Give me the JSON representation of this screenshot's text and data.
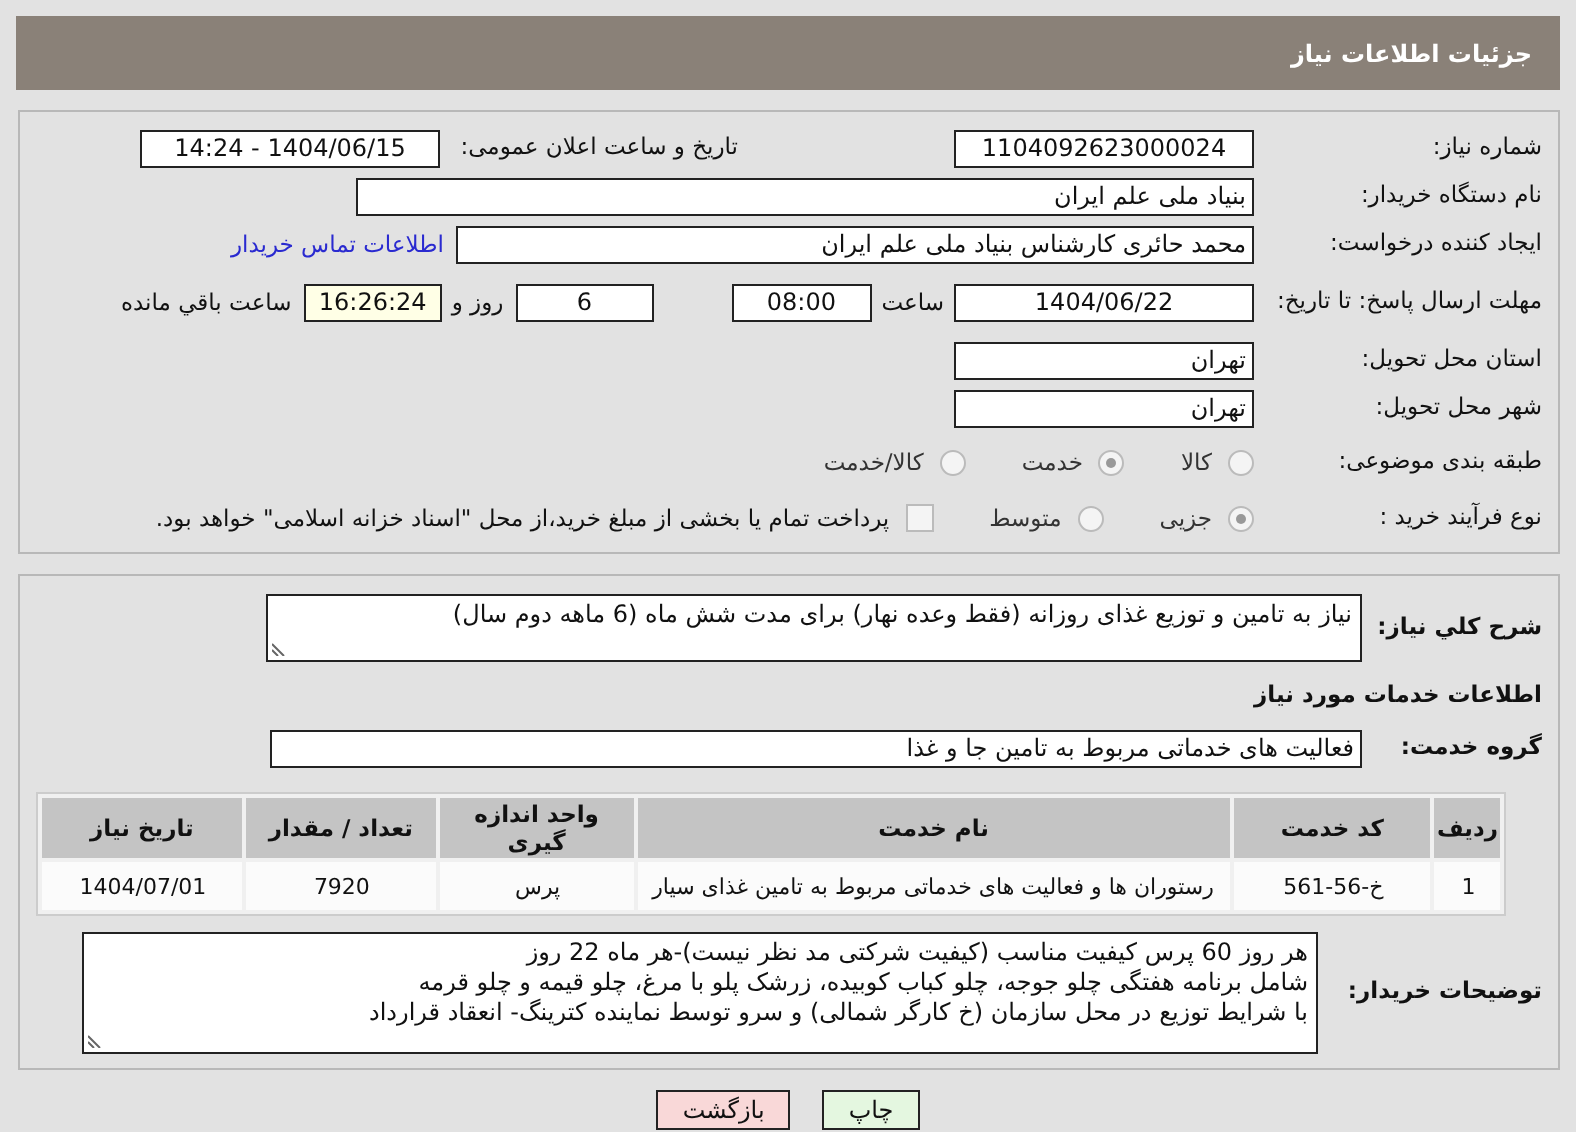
{
  "header": {
    "title": "جزئیات اطلاعات نیاز"
  },
  "need_number": {
    "label": "شماره نیاز:",
    "value": "1104092623000024"
  },
  "announce": {
    "label": "تاریخ و ساعت اعلان عمومی:",
    "value": "1404/06/15 - 14:24"
  },
  "buyer": {
    "label": "نام دستگاه خریدار:",
    "value": "بنیاد ملی علم ایران"
  },
  "creator": {
    "label": "ایجاد کننده درخواست:",
    "value": "محمد حائری کارشناس بنیاد ملی علم ایران",
    "link": "اطلاعات تماس خریدار"
  },
  "deadline": {
    "label": "مهلت ارسال پاسخ: تا تاریخ:",
    "date": "1404/06/22",
    "time_label": "ساعت",
    "time": "08:00",
    "days": "6",
    "days_label": "روز و",
    "remaining": "16:26:24",
    "remaining_label": "ساعت باقي مانده"
  },
  "province": {
    "label": "استان محل تحویل:",
    "value": "تهران"
  },
  "city": {
    "label": "شهر محل تحویل:",
    "value": "تهران"
  },
  "category": {
    "label": "طبقه بندی موضوعی:",
    "options": [
      {
        "label": "کالا",
        "selected": false
      },
      {
        "label": "خدمت",
        "selected": true
      },
      {
        "label": "کالا/خدمت",
        "selected": false
      }
    ]
  },
  "process": {
    "label": "نوع فرآیند خرید :",
    "options": [
      {
        "label": "جزیی",
        "selected": true
      },
      {
        "label": "متوسط",
        "selected": false
      }
    ],
    "payment": {
      "checked": false,
      "text": "پرداخت تمام یا بخشی از مبلغ خرید،از محل \"اسناد خزانه اسلامی\" خواهد بود."
    }
  },
  "summary": {
    "label": "شرح کلي نياز:",
    "value": "نیاز به تامین و توزیع غذای روزانه (فقط وعده نهار) برای مدت شش ماه (6 ماهه دوم سال)"
  },
  "services_title": "اطلاعات خدمات مورد نياز",
  "service_group": {
    "label": "گروه خدمت:",
    "value": "فعالیت های خدماتی مربوط به تامین جا و غذا"
  },
  "table": {
    "columns": [
      "ردیف",
      "کد خدمت",
      "نام خدمت",
      "واحد اندازه گیری",
      "تعداد / مقدار",
      "تاریخ نیاز"
    ],
    "rows": [
      [
        "1",
        "خ-56-561",
        "رستوران ها و فعالیت های خدماتی مربوط به تامین غذای سیار",
        "پرس",
        "7920",
        "1404/07/01"
      ]
    ]
  },
  "buyer_notes": {
    "label": "توضیحات خریدار:",
    "value": "هر روز 60 پرس کیفیت مناسب (کیفیت شرکتی مد نظر نیست)-هر ماه 22 روز\nشامل برنامه هفتگی چلو جوجه، چلو کباب کوبیده، زرشک پلو با مرغ، چلو قیمه و چلو قرمه\nبا شرایط توزیع در محل سازمان (خ کارگر شمالی) و سرو توسط نماینده کترینگ- انعقاد قرارداد"
  },
  "buttons": [
    {
      "label": "چاپ",
      "kind": "print"
    },
    {
      "label": "بازگشت",
      "kind": "back"
    }
  ]
}
